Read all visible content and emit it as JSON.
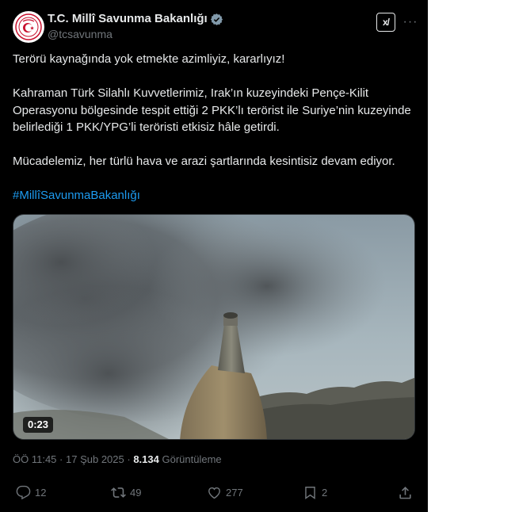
{
  "account": {
    "display_name": "T.C. Millî Savunma Bakanlığı",
    "handle": "@tcsavunma",
    "avatar_icon": "ministry-emblem-icon",
    "verified_color": "#829aab"
  },
  "header_buttons": {
    "grok_label": "x/",
    "more_label": "···"
  },
  "tweet": {
    "line1": "Terörü kaynağında yok etmekte azimliyiz, kararlıyız!",
    "line2": "Kahraman Türk Silahlı Kuvvetlerimiz, Irak’ın kuzeyindeki Pençe-Kilit Operasyonu bölgesinde tespit ettiği 2 PKK’lı terörist ile Suriye’nin kuzeyinde belirlediği 1 PKK/YPG’li teröristi etkisiz hâle getirdi.",
    "line3": "Mücadelemiz, her türlü hava ve arazi şartlarında kesintisiz devam ediyor.",
    "hashtag": "#MillîSavunmaBakanlığı"
  },
  "media": {
    "duration": "0:23"
  },
  "meta": {
    "time": "ÖÖ 11:45",
    "separator": "·",
    "date": "17 Şub 2025",
    "views_count": "8.134",
    "views_label": "Görüntüleme"
  },
  "actions": {
    "replies": "12",
    "reposts": "49",
    "likes": "277",
    "bookmarks": "2"
  },
  "colors": {
    "background": "#000000",
    "text": "#e7e9ea",
    "secondary": "#71767b",
    "link": "#1d9bf0"
  }
}
